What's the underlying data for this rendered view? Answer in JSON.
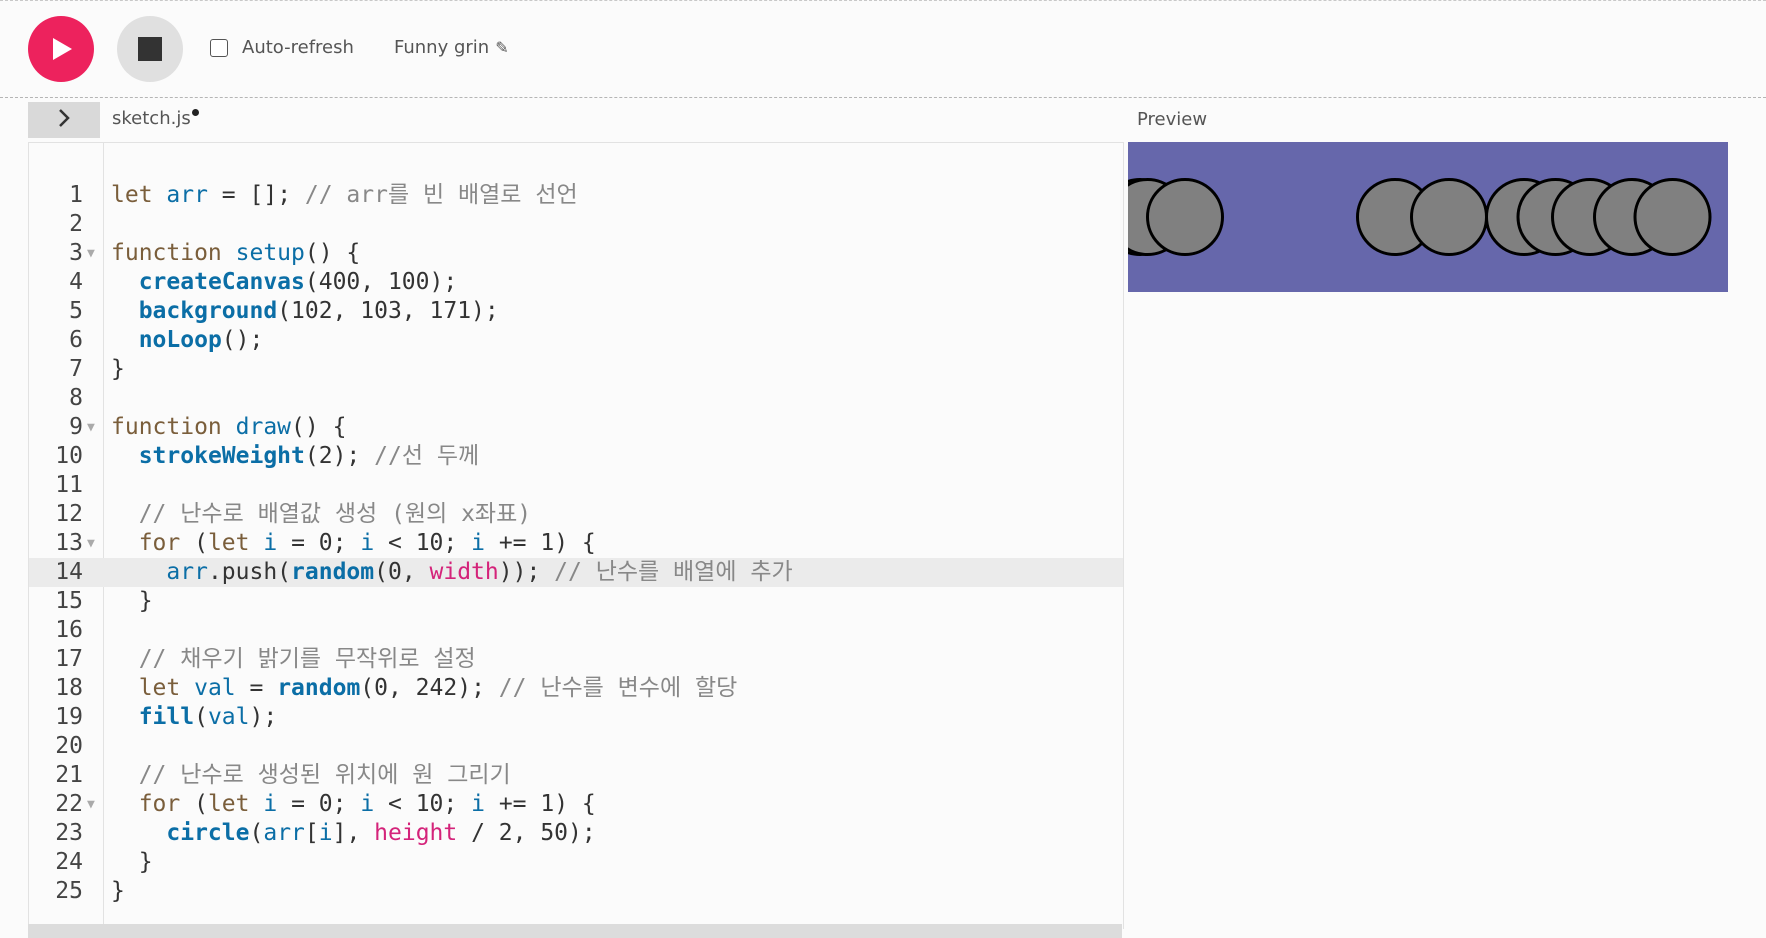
{
  "toolbar": {
    "play_icon": "play-icon",
    "stop_icon": "stop-icon",
    "auto_refresh_label": "Auto-refresh",
    "auto_refresh_checked": false,
    "sketch_name": "Funny grin",
    "edit_icon": "pencil-icon",
    "accent_color": "#ed225d"
  },
  "editor": {
    "sidebar_toggle_icon": "chevron-right-icon",
    "file_tab": "sketch.js",
    "unsaved": true,
    "active_line": 14,
    "lines": [
      {
        "n": "1",
        "fold": false,
        "code": "let arr = []; // arr를 빈 배열로 선언"
      },
      {
        "n": "2",
        "fold": false,
        "code": ""
      },
      {
        "n": "3",
        "fold": true,
        "code": "function setup() {"
      },
      {
        "n": "4",
        "fold": false,
        "code": "  createCanvas(400, 100);"
      },
      {
        "n": "5",
        "fold": false,
        "code": "  background(102, 103, 171);"
      },
      {
        "n": "6",
        "fold": false,
        "code": "  noLoop();"
      },
      {
        "n": "7",
        "fold": false,
        "code": "}"
      },
      {
        "n": "8",
        "fold": false,
        "code": ""
      },
      {
        "n": "9",
        "fold": true,
        "code": "function draw() {"
      },
      {
        "n": "10",
        "fold": false,
        "code": "  strokeWeight(2); //선 두께"
      },
      {
        "n": "11",
        "fold": false,
        "code": ""
      },
      {
        "n": "12",
        "fold": false,
        "code": "  // 난수로 배열값 생성 (원의 x좌표)"
      },
      {
        "n": "13",
        "fold": true,
        "code": "  for (let i = 0; i < 10; i += 1) {"
      },
      {
        "n": "14",
        "fold": false,
        "code": "    arr.push(random(0, width)); // 난수를 배열에 추가"
      },
      {
        "n": "15",
        "fold": false,
        "code": "  }"
      },
      {
        "n": "16",
        "fold": false,
        "code": ""
      },
      {
        "n": "17",
        "fold": false,
        "code": "  // 채우기 밝기를 무작위로 설정"
      },
      {
        "n": "18",
        "fold": false,
        "code": "  let val = random(0, 242); // 난수를 변수에 할당"
      },
      {
        "n": "19",
        "fold": false,
        "code": "  fill(val);"
      },
      {
        "n": "20",
        "fold": false,
        "code": ""
      },
      {
        "n": "21",
        "fold": false,
        "code": "  // 난수로 생성된 위치에 원 그리기"
      },
      {
        "n": "22",
        "fold": true,
        "code": "  for (let i = 0; i < 10; i += 1) {"
      },
      {
        "n": "23",
        "fold": false,
        "code": "    circle(arr[i], height / 2, 50);"
      },
      {
        "n": "24",
        "fold": false,
        "code": "  }"
      },
      {
        "n": "25",
        "fold": false,
        "code": "}"
      }
    ]
  },
  "preview": {
    "label": "Preview",
    "canvas_width": 400,
    "canvas_height": 100,
    "background": "#6667ab",
    "circle_fill": "#808080",
    "circle_diameter": 50,
    "circle_x": [
      8,
      13,
      38,
      178,
      214,
      264,
      285,
      308,
      336,
      363
    ]
  }
}
